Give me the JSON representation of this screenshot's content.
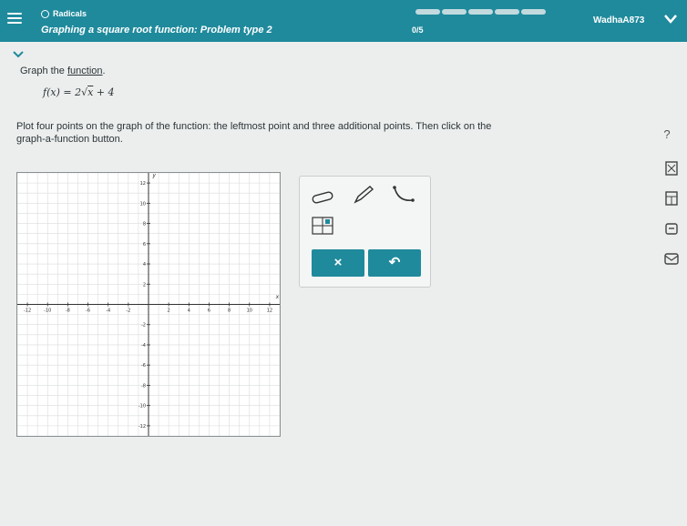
{
  "header": {
    "topic": "Radicals",
    "problem_title": "Graphing a square root function: Problem type 2",
    "progress_count": "0/5",
    "progress": 0,
    "username": "WadhaA873",
    "bg_color": "#1f8a9c"
  },
  "instructions": {
    "graph_prefix": "Graph the ",
    "graph_link": "function",
    "graph_suffix": ".",
    "formula_lhs": "f(x) = 2",
    "formula_radicand": "x",
    "formula_rhs": " + 4",
    "plot_text_1": "Plot four points on the graph of the function: the leftmost point and three additional points. Then click on the",
    "plot_text_2": "graph-a-function button."
  },
  "help": {
    "label": "?"
  },
  "graph": {
    "x_axis_label": "x",
    "y_axis_label": "y",
    "x_range": [
      -13,
      13
    ],
    "y_range": [
      -13,
      13
    ],
    "x_ticks": [
      "-12",
      "-10",
      "-8",
      "-6",
      "-4",
      "-2",
      "2",
      "4",
      "6",
      "8",
      "10",
      "12"
    ],
    "y_ticks": [
      "12",
      "10",
      "8",
      "6",
      "4",
      "2",
      "-2",
      "-4",
      "-6",
      "-8",
      "-10",
      "-12"
    ]
  },
  "toolbox": {
    "tools": [
      "eraser-tool",
      "pencil-tool",
      "curve-tool",
      "graph-a-function-tool"
    ],
    "x_label": "×",
    "undo_label": "↶"
  },
  "side_tools": [
    "calculator-icon",
    "data-icon",
    "lock-icon",
    "mail-icon"
  ]
}
